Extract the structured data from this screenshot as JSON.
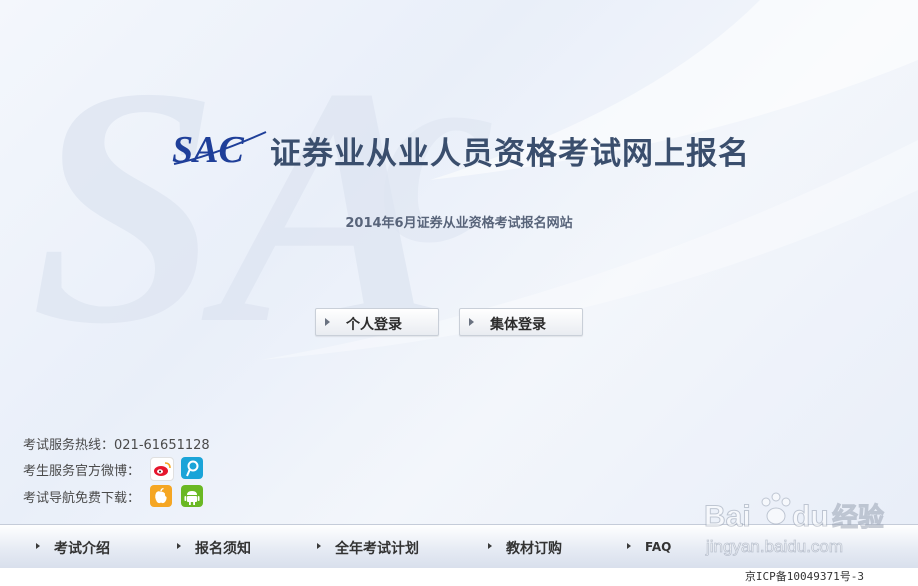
{
  "header": {
    "logo_text": "SAC",
    "title": "证券业从业人员资格考试网上报名",
    "subtitle": "2014年6月证券从业资格考试报名网站"
  },
  "login": {
    "personal_label": "个人登录",
    "group_label": "集体登录"
  },
  "info": {
    "hotline": "考试服务热线：021-61651128",
    "weibo": "考生服务官方微博：",
    "download": "考试导航免费下载："
  },
  "nav": {
    "items": [
      {
        "label": "考试介绍"
      },
      {
        "label": "报名须知"
      },
      {
        "label": "全年考试计划"
      },
      {
        "label": "教材订购"
      },
      {
        "label": "FAQ"
      }
    ]
  },
  "footer": {
    "icp": "京ICP备10049371号-3"
  },
  "watermark": {
    "brand": "Bai",
    "brand2": "du",
    "cn": "经验",
    "url": "jingyan.baidu.com"
  },
  "colors": {
    "title": "#3a4e6d",
    "logo": "#1f3f99",
    "weibo": "#e6162d",
    "tencent_weibo": "#1aa4d8",
    "apple": "#f5a623",
    "android": "#6ab823"
  }
}
